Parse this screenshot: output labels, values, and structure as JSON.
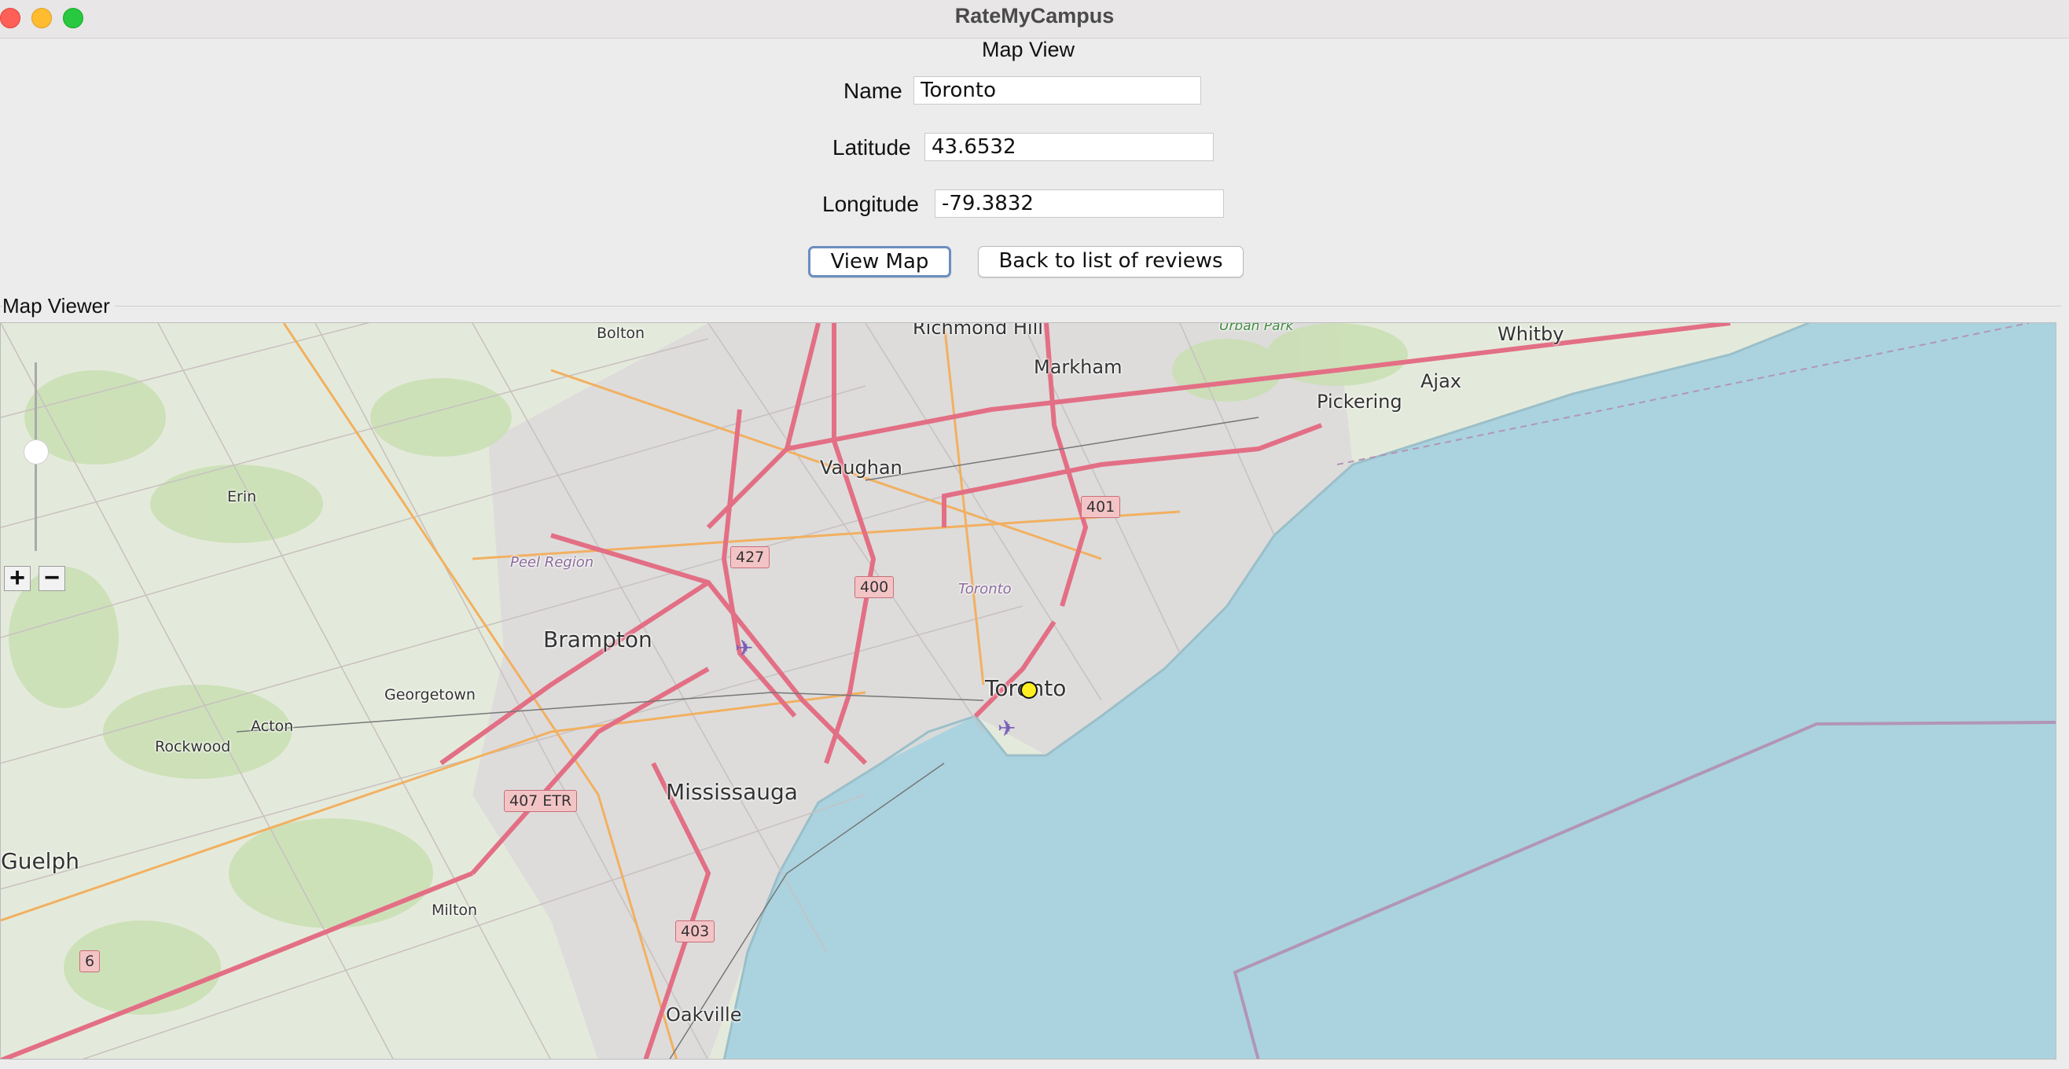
{
  "window": {
    "title": "RateMyCampus"
  },
  "form": {
    "heading": "Map View",
    "name_label": "Name",
    "name_value": "Toronto",
    "latitude_label": "Latitude",
    "latitude_value": "43.6532",
    "longitude_label": "Longitude",
    "longitude_value": "-79.3832",
    "view_map_label": "View Map",
    "back_label": "Back to list of reviews"
  },
  "map_viewer": {
    "group_title": "Map Viewer",
    "zoom_in": "+",
    "zoom_out": "−",
    "marker_color": "#ffee22",
    "water_color": "#aad3df",
    "land_color": "#e4eadb",
    "places": {
      "richmond_hill": "Richmond Hill",
      "bolton": "Bolton",
      "markham": "Markham",
      "urban_park": "Urban Park",
      "whitby": "Whitby",
      "ajax": "Ajax",
      "pickering": "Pickering",
      "vaughan": "Vaughan",
      "erin": "Erin",
      "peel_region": "Peel Region",
      "toronto_region": "Toronto",
      "brampton": "Brampton",
      "toronto": "Toronto",
      "georgetown": "Georgetown",
      "acton": "Acton",
      "rockwood": "Rockwood",
      "mississauga": "Mississauga",
      "guelph": "Guelph",
      "milton": "Milton",
      "oakville": "Oakville"
    },
    "shields": {
      "h401": "401",
      "h427": "427",
      "h400": "400",
      "h407": "407 ETR",
      "h403": "403",
      "h6": "6"
    },
    "airport_icon": "airplane-icon"
  }
}
